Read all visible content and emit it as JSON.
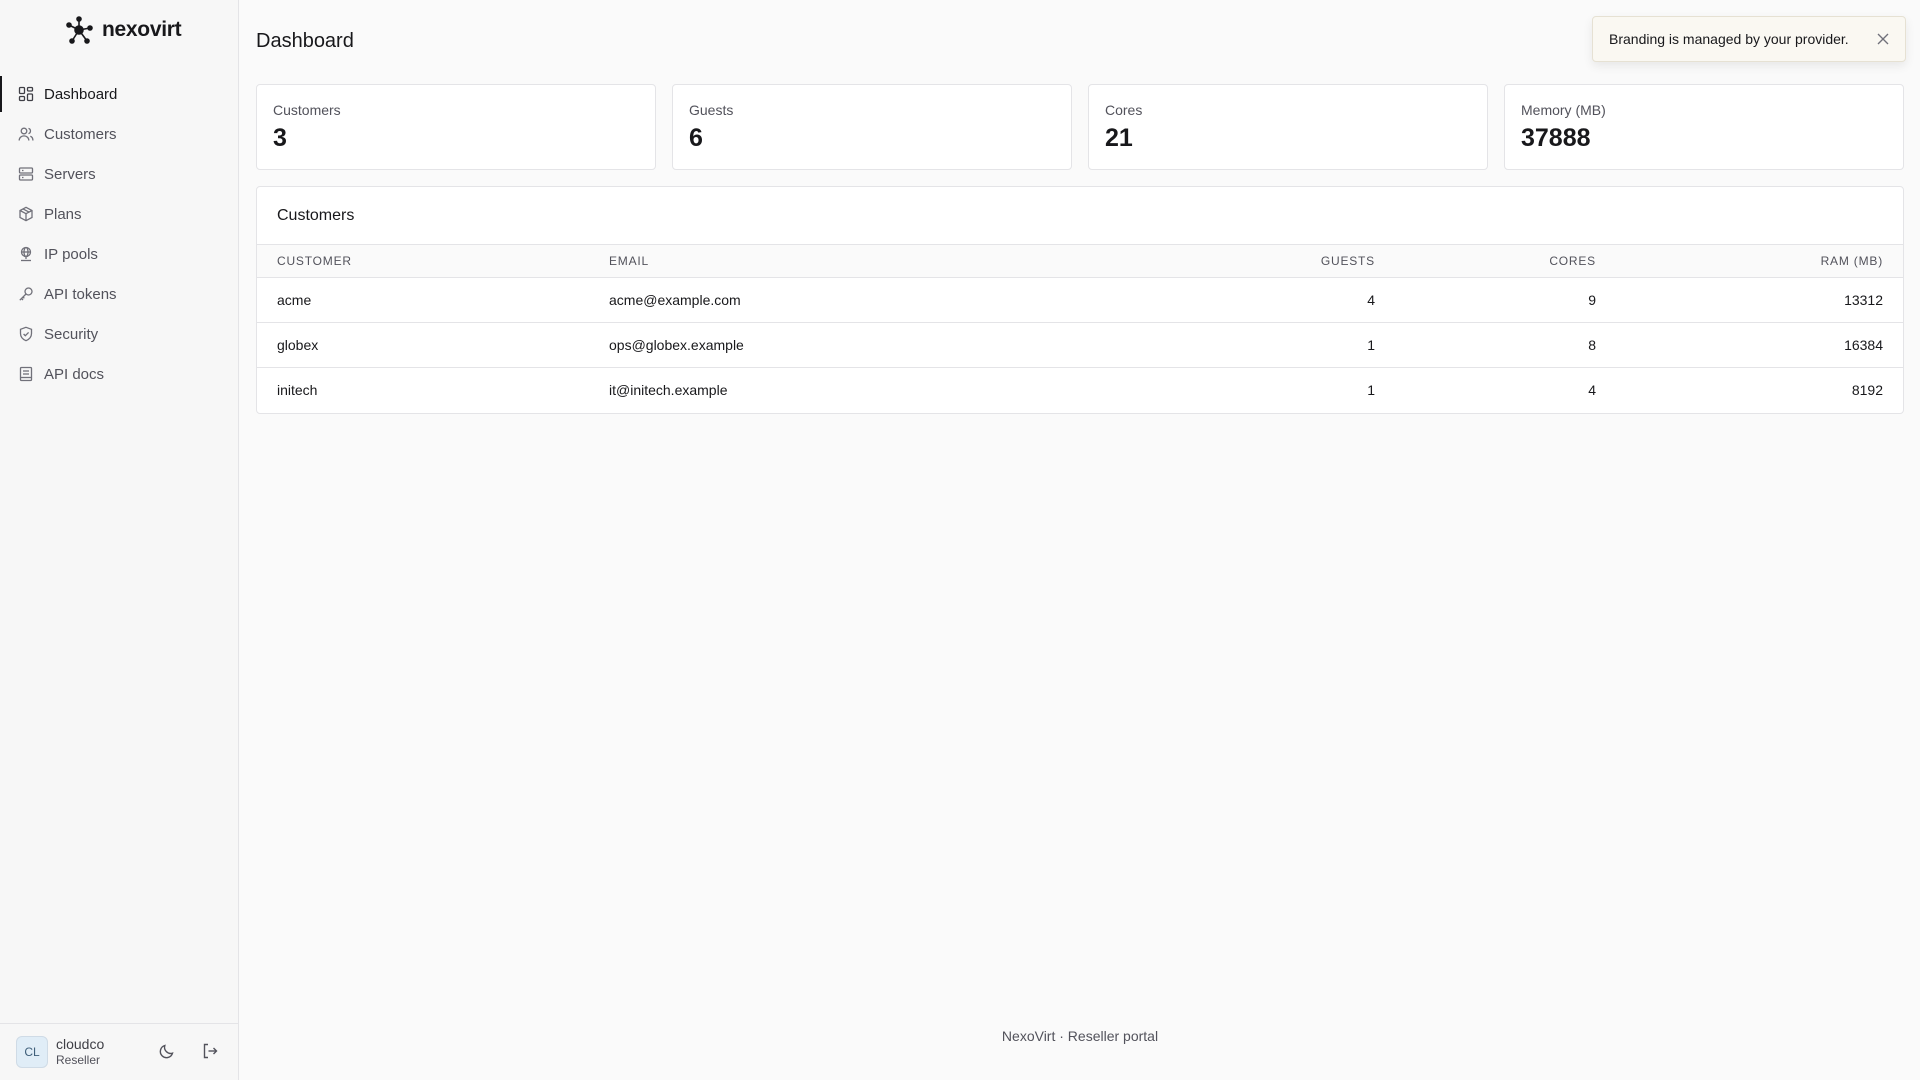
{
  "brand": {
    "name": "nexovirt"
  },
  "sidebar": {
    "items": [
      {
        "label": "Dashboard",
        "icon": "dashboard-icon",
        "active": true
      },
      {
        "label": "Customers",
        "icon": "users-icon"
      },
      {
        "label": "Servers",
        "icon": "server-icon"
      },
      {
        "label": "Plans",
        "icon": "package-icon"
      },
      {
        "label": "IP pools",
        "icon": "globe-network-icon"
      },
      {
        "label": "API tokens",
        "icon": "key-icon"
      },
      {
        "label": "Security",
        "icon": "shield-icon"
      },
      {
        "label": "API docs",
        "icon": "book-icon"
      }
    ],
    "user": {
      "initials": "CL",
      "name": "cloudco",
      "role": "Reseller"
    }
  },
  "page": {
    "title": "Dashboard"
  },
  "stats": [
    {
      "label": "Customers",
      "value": "3"
    },
    {
      "label": "Guests",
      "value": "6"
    },
    {
      "label": "Cores",
      "value": "21"
    },
    {
      "label": "Memory (MB)",
      "value": "37888"
    }
  ],
  "customers_table": {
    "title": "Customers",
    "columns": [
      "CUSTOMER",
      "EMAIL",
      "GUESTS",
      "CORES",
      "RAM (MB)"
    ],
    "rows": [
      {
        "customer": "acme",
        "email": "acme@example.com",
        "guests": "4",
        "cores": "9",
        "ram": "13312"
      },
      {
        "customer": "globex",
        "email": "ops@globex.example",
        "guests": "1",
        "cores": "8",
        "ram": "16384"
      },
      {
        "customer": "initech",
        "email": "it@initech.example",
        "guests": "1",
        "cores": "4",
        "ram": "8192"
      }
    ]
  },
  "footer": {
    "text": "NexoVirt · Reseller portal"
  },
  "toast": {
    "message": "Branding is managed by your provider."
  },
  "colors": {
    "accent": "#18181b",
    "muted": "#52525b",
    "border": "#e4e4e7",
    "background": "#fafafa"
  }
}
